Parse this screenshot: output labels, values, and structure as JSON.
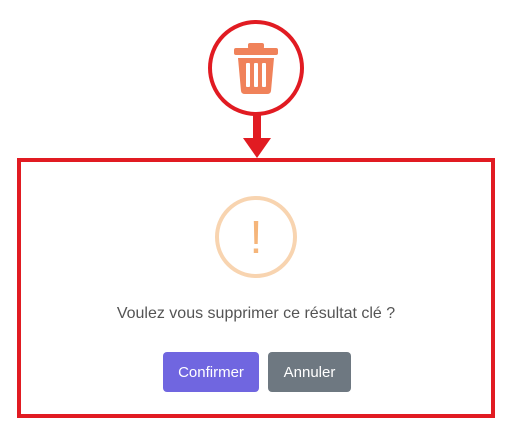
{
  "callout": {
    "icon": "trash-icon",
    "icon_color": "#f0825a",
    "highlight_color": "#e11b22"
  },
  "dialog": {
    "icon": "exclamation-warning-icon",
    "icon_glyph": "!",
    "message": "Voulez vous supprimer ce résultat clé ?",
    "confirm_label": "Confirmer",
    "cancel_label": "Annuler",
    "confirm_color": "#7066e0",
    "cancel_color": "#6e7881"
  }
}
